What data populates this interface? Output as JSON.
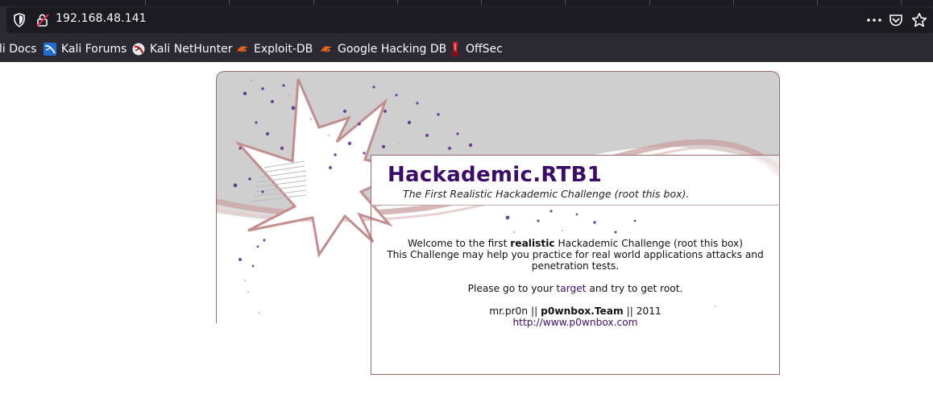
{
  "browser": {
    "url": "192.168.48.141",
    "bookmarks": [
      {
        "label": "li Docs",
        "icon": "kali-docs-icon"
      },
      {
        "label": "Kali Forums",
        "icon": "kali-forums-icon"
      },
      {
        "label": "Kali NetHunter",
        "icon": "kali-nethunter-icon"
      },
      {
        "label": "Exploit-DB",
        "icon": "exploit-db-icon"
      },
      {
        "label": "Google Hacking DB",
        "icon": "ghdb-icon"
      },
      {
        "label": "OffSec",
        "icon": "offsec-icon"
      }
    ],
    "colors": {
      "toolbar": "#2b2a33",
      "urlbar": "#1c1b22",
      "text": "#fbfbfe"
    }
  },
  "page": {
    "title": "Hackademic.RTB1",
    "subtitle": "The First Realistic Hackademic Challenge (root this box).",
    "welcome_prefix": "Welcome to the first ",
    "welcome_bold": "realistic",
    "welcome_suffix": " Hackademic Challenge (root this box)",
    "line2": "This Challenge may help you practice for real world applications attacks and",
    "line3": "penetration tests.",
    "goto_prefix": "Please go to your ",
    "goto_link": "target",
    "goto_suffix": " and try to get root.",
    "credit_prefix": "mr.pr0n || ",
    "credit_bold": "p0wnbox.Team",
    "credit_suffix": " || 2011",
    "site_link": "http://www.p0wnbox.com",
    "colors": {
      "title": "#3b0d6b",
      "link": "#3b0d6b",
      "border": "#9a6a6a"
    }
  }
}
